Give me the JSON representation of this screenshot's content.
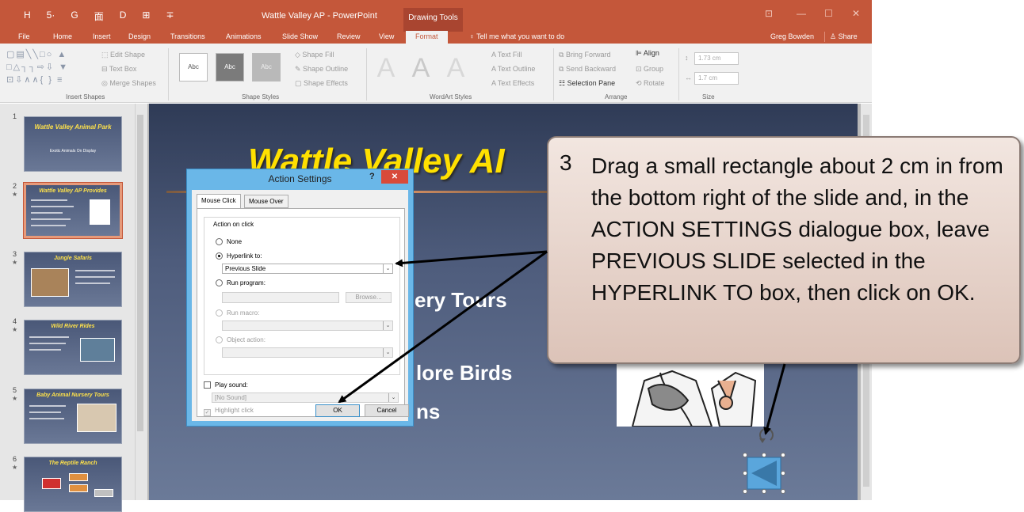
{
  "window": {
    "title": "Wattle Valley AP - PowerPoint",
    "contextual_tab_group": "Drawing Tools",
    "qat": [
      "H",
      "5·",
      "G",
      "面",
      "D",
      "⊞",
      "∓"
    ],
    "win_controls": [
      "⊡",
      "—",
      "☐",
      "✕"
    ]
  },
  "menu": {
    "tabs": [
      "File",
      "Home",
      "Insert",
      "Design",
      "Transitions",
      "Animations",
      "Slide Show",
      "Review",
      "View",
      "Format"
    ],
    "active_tab": "Format",
    "tell_me": "Tell me what you want to do",
    "user": "Greg Bowden",
    "share": "Share"
  },
  "ribbon": {
    "insert_shapes": {
      "label": "Insert Shapes",
      "edit_shape": "Edit Shape",
      "text_box": "Text Box",
      "merge_shapes": "Merge Shapes",
      "shape_rows": [
        "▢▤╲╲□○ ▲",
        "□△┐┐⇨⇩ ▼",
        "⊡⇩∧∧{ } ≡"
      ]
    },
    "shape_styles": {
      "label": "Shape Styles",
      "swatch_text": "Abc",
      "fill": "Shape Fill",
      "outline": "Shape Outline",
      "effects": "Shape Effects"
    },
    "wordart_styles": {
      "label": "WordArt Styles",
      "letter": "A",
      "text_fill": "Text Fill",
      "text_outline": "Text Outline",
      "text_effects": "Text Effects"
    },
    "arrange": {
      "label": "Arrange",
      "bring_forward": "Bring Forward",
      "send_backward": "Send Backward",
      "selection_pane": "Selection Pane",
      "align": "Align",
      "group": "Group",
      "rotate": "Rotate"
    },
    "size": {
      "label": "Size",
      "height": "1.73 cm",
      "width": "1.7 cm"
    }
  },
  "slides_panel": {
    "thumbnails": [
      {
        "num": "1",
        "title": "Wattle Valley Animal Park",
        "sub": "Exotic Animals On Display"
      },
      {
        "num": "2",
        "title": "Wattle Valley AP Provides"
      },
      {
        "num": "3",
        "title": "Jungle Safaris"
      },
      {
        "num": "4",
        "title": "Wild River Rides"
      },
      {
        "num": "5",
        "title": "Baby Animal Nursery Tours"
      },
      {
        "num": "6",
        "title": "The Reptile Ranch"
      }
    ],
    "star": "★"
  },
  "slide": {
    "title": "Wattle Valley AI",
    "bullets": [
      "ery Tours",
      "lore Birds",
      "ns"
    ]
  },
  "dialog": {
    "title": "Action Settings",
    "help": "?",
    "close": "✕",
    "tabs": [
      "Mouse Click",
      "Mouse Over"
    ],
    "group": "Action on click",
    "none": "None",
    "hyperlink_to": "Hyperlink to:",
    "hyperlink_value": "Previous Slide",
    "run_program": "Run program:",
    "browse": "Browse...",
    "run_macro": "Run macro:",
    "object_action": "Object action:",
    "play_sound": "Play sound:",
    "sound_value": "[No Sound]",
    "highlight_click": "Highlight click",
    "ok": "OK",
    "cancel": "Cancel"
  },
  "callout": {
    "step": "3",
    "text": "Drag a small rectangle about 2 cm in from the bottom right of the slide and, in the ACTION SETTINGS dialogue box, leave PREVIOUS SLIDE selected in the HYPERLINK TO box, then click on OK."
  },
  "colors": {
    "accent": "#c4573a",
    "dialog_frame": "#6ab7e8",
    "slide_title": "#ffe000"
  }
}
